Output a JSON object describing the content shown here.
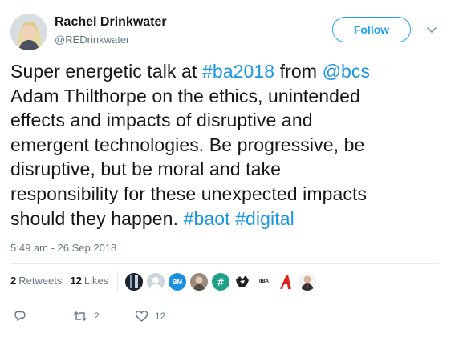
{
  "user": {
    "name": "Rachel Drinkwater",
    "handle": "@REDrinkwater"
  },
  "follow_label": "Follow",
  "text": {
    "l1_a": "Super energetic talk at ",
    "l1_tag": "#ba2018",
    "l1_b": " from ",
    "l1_mention": "@bcs",
    "l2": "Adam Thilthorpe on the ethics, unintended",
    "l3": "effects and impacts of disruptive and",
    "l4": "emergent technologies. Be progressive, be",
    "l5": "disruptive, but be moral and take",
    "l6": "responsibility for these unexpected impacts",
    "l7_a": "should they happen. ",
    "l7_tag1": "#baot",
    "l7_tag2": "#digital"
  },
  "timestamp": "5:49 am - 26 Sep 2018",
  "stats": {
    "retweets_count": "2",
    "retweets_label": "Retweets",
    "likes_count": "12",
    "likes_label": "Likes"
  },
  "liker_avatars": {
    "a3_text": "BM",
    "a6_text": "#",
    "a8_text": "IIBA"
  },
  "actions": {
    "retweet_count": "2",
    "like_count": "12"
  },
  "colors": {
    "link": "#1b95e0",
    "follow": "#1da1f2",
    "muted": "#657786"
  }
}
